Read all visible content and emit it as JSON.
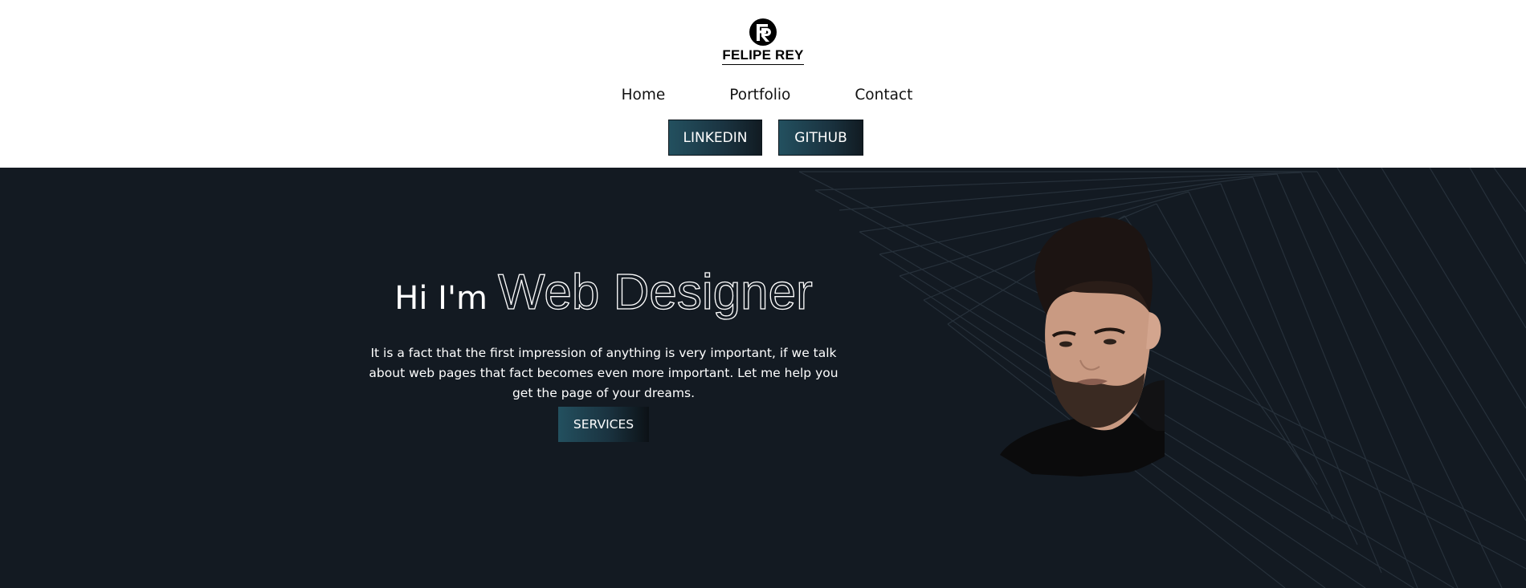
{
  "header": {
    "logo_text": "FELIPE REY",
    "nav": [
      {
        "label": "Home"
      },
      {
        "label": "Portfolio"
      },
      {
        "label": "Contact"
      }
    ],
    "social": {
      "linkedin_label": "LINKEDIN",
      "github_label": "GITHUB"
    }
  },
  "hero": {
    "greeting": "Hi I'm",
    "role": "Web Designer",
    "description": "It is a fact that the first impression of anything is very important, if we talk about web pages that fact becomes even more important. Let me help you get the page of your dreams.",
    "services_label": "SERVICES"
  },
  "colors": {
    "hero_background": "#131a22",
    "button_gradient_start": "#23505f",
    "button_gradient_end": "#111b22",
    "header_background": "#ffffff"
  },
  "icons": {
    "logo": "fr-monogram-icon",
    "portrait": "profile-photo"
  }
}
